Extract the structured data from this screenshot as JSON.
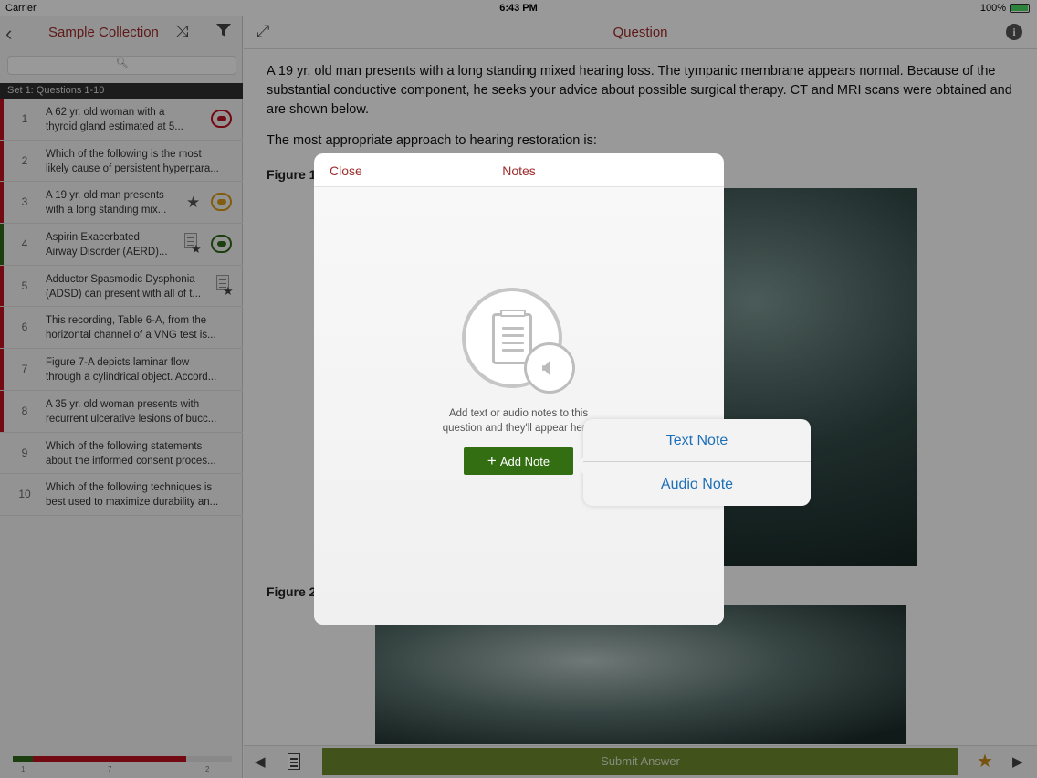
{
  "status_bar": {
    "carrier": "Carrier",
    "time": "6:43 PM",
    "battery": "100%"
  },
  "sidebar": {
    "title": "Sample Collection",
    "section_label": "Set 1: Questions 1-10",
    "search_icon": "search-icon",
    "items": [
      {
        "num": "1",
        "line1": "A 62 yr. old woman with a",
        "line2": "thyroid gland estimated at 5...",
        "mark_color": "#c01020",
        "pill_color": "#c01020"
      },
      {
        "num": "2",
        "line1": "Which of the following is the most",
        "line2": "likely cause of persistent hyperpara...",
        "mark_color": "#c01020"
      },
      {
        "num": "3",
        "line1": "A 19 yr. old man presents",
        "line2": "with a long standing mix...",
        "mark_color": "#c01020",
        "pill_color": "#d99a1a",
        "starred": true
      },
      {
        "num": "4",
        "line1": "Aspirin Exacerbated",
        "line2": "Airway Disorder (AERD)...",
        "mark_color": "#2f6a1a",
        "pill_color": "#2f6a1a",
        "note": true
      },
      {
        "num": "5",
        "line1": "Adductor Spasmodic Dysphonia",
        "line2": "(ADSD) can present with all of t...",
        "mark_color": "#c01020",
        "note": true
      },
      {
        "num": "6",
        "line1": "This recording, Table 6-A, from the",
        "line2": "horizontal channel of a VNG test is...",
        "mark_color": "#c01020"
      },
      {
        "num": "7",
        "line1": "Figure 7-A depicts laminar flow",
        "line2": "through a cylindrical object. Accord...",
        "mark_color": "#c01020"
      },
      {
        "num": "8",
        "line1": "A 35 yr. old woman presents with",
        "line2": "recurrent ulcerative lesions of bucc...",
        "mark_color": "#c01020"
      },
      {
        "num": "9",
        "line1": "Which of the following statements",
        "line2": "about the informed consent proces...",
        "mark_color": ""
      },
      {
        "num": "10",
        "line1": "Which of the following techniques is",
        "line2": "best used to maximize durability an...",
        "mark_color": ""
      }
    ],
    "progress": {
      "correct": 1,
      "incorrect": 7,
      "total": 10,
      "ticks": [
        "1",
        "7",
        "2"
      ]
    }
  },
  "main": {
    "title": "Question",
    "question": "A 19 yr. old man presents with a long standing mixed hearing loss. The tympanic membrane appears normal. Because of the substantial conductive component, he seeks your advice about possible surgical therapy. CT and MRI scans were obtained and are shown below.",
    "prompt": "The most appropriate approach to hearing restoration is:",
    "figure1_label": "Figure 1",
    "figure2_label": "Figure 2",
    "submit_label": "Submit Answer"
  },
  "modal": {
    "close_label": "Close",
    "title": "Notes",
    "desc_line1": "Add text or audio notes to this",
    "desc_line2": "question and they'll appear here.",
    "add_label": "Add Note"
  },
  "popover": {
    "text_note": "Text Note",
    "audio_note": "Audio Note"
  }
}
